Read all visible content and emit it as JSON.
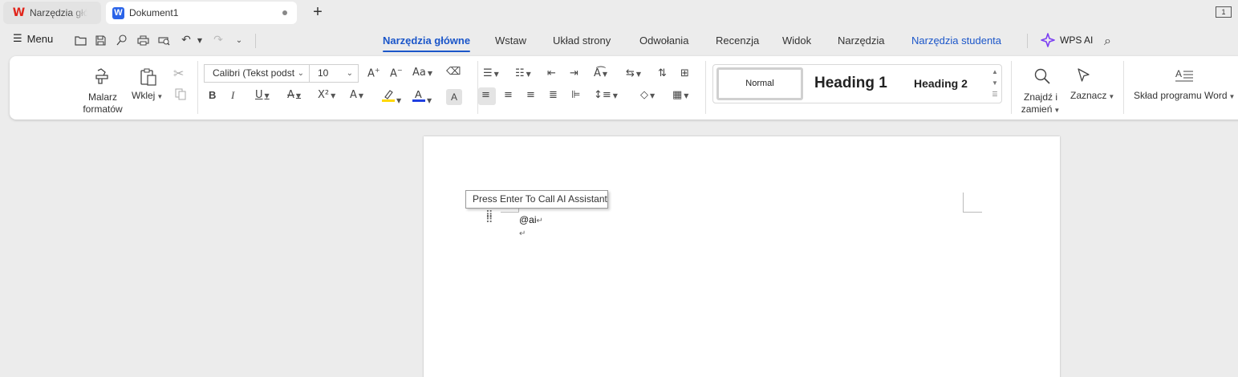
{
  "tabs": [
    {
      "label": "Narzędzia głó",
      "icon": "wps-logo-icon"
    },
    {
      "label": "Dokument1",
      "icon": "writer-doc-icon",
      "logo_letter": "W",
      "unsaved": true
    }
  ],
  "title_bar": {
    "new_tab_symbol": "+",
    "page_indicator": "1"
  },
  "menu": {
    "menu_label": "Menu",
    "tabs": [
      "Narzędzia główne",
      "Wstaw",
      "Układ strony",
      "Odwołania",
      "Recenzja",
      "Widok",
      "Narzędzia",
      "Narzędzia studenta"
    ],
    "active_tab": "Narzędzia główne",
    "wps_ai_label": "WPS AI"
  },
  "ribbon": {
    "format_painter": "Malarz formatów",
    "paste": "Wklej",
    "font_name": "Calibri (Tekst podst",
    "font_size": "10",
    "styles": [
      "Normal",
      "Heading 1",
      "Heading 2"
    ],
    "find_replace": "Znajdź i zamień",
    "select": "Zaznacz",
    "word_layout": "Skład programu Word",
    "highlight_color": "#ffd800",
    "font_color": "#1f3fe0"
  },
  "document": {
    "tooltip": "Press Enter To Call AI Assistant",
    "lines": [
      "@ai",
      ""
    ]
  }
}
